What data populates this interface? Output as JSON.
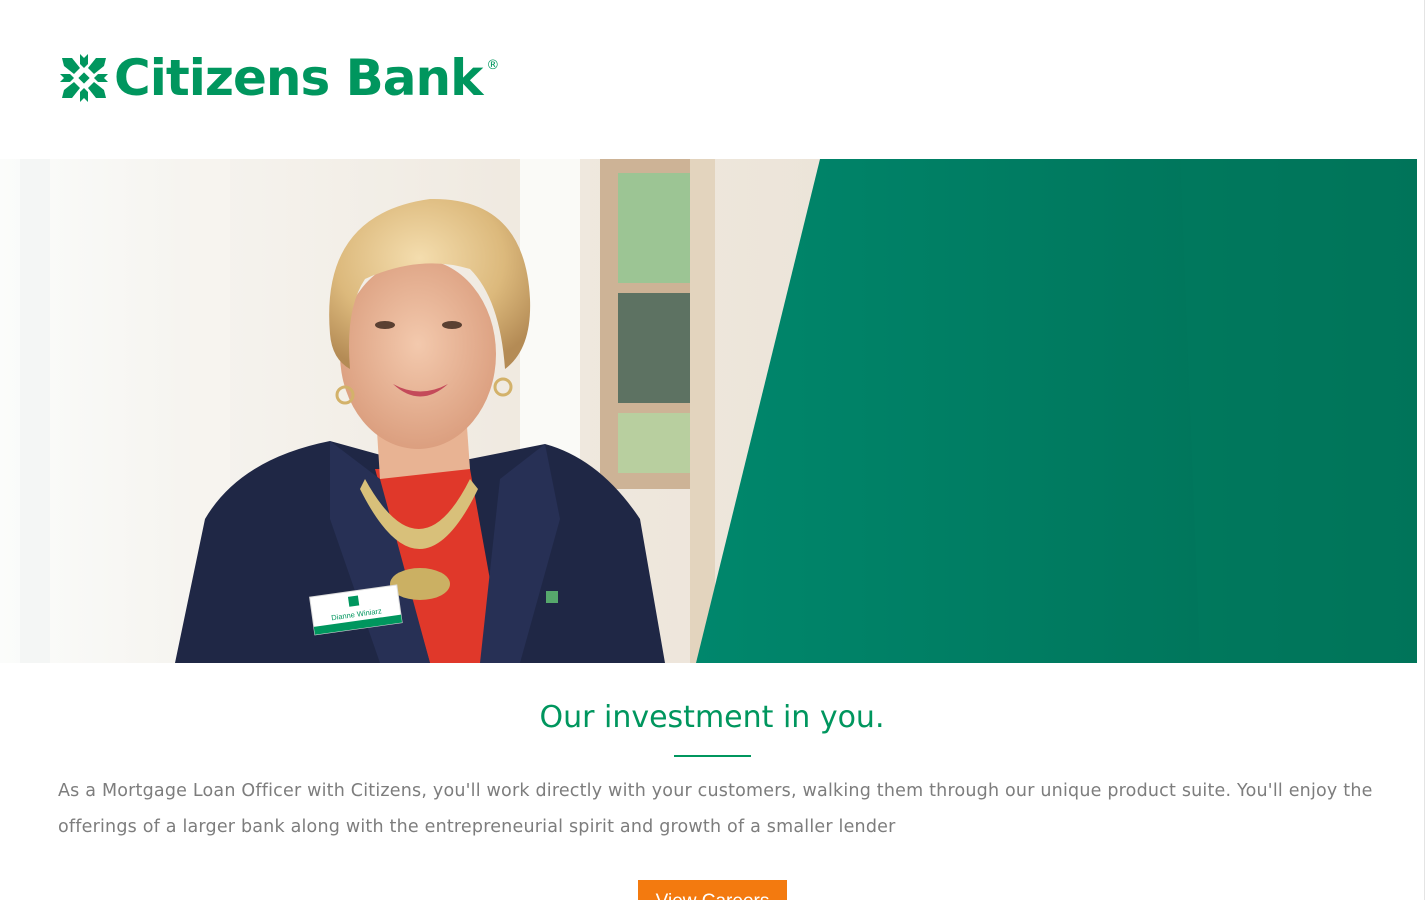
{
  "brand": {
    "name": "Citizens Bank",
    "registered": "®",
    "color": "#00965e"
  },
  "hero": {
    "alt": "Citizens Bank team member portrait",
    "name_tag": "Dianne Winiarz",
    "panel_color": "#007a63"
  },
  "content": {
    "headline": "Our investment in you.",
    "body": "As a Mortgage Loan Officer with Citizens, you'll work directly with your customers, walking them through our unique product suite. You'll enjoy the offerings of a larger bank along with the entrepreneurial spirit and growth of a smaller lender",
    "cta_label": "View Careers",
    "cta_color": "#f37a0f"
  }
}
